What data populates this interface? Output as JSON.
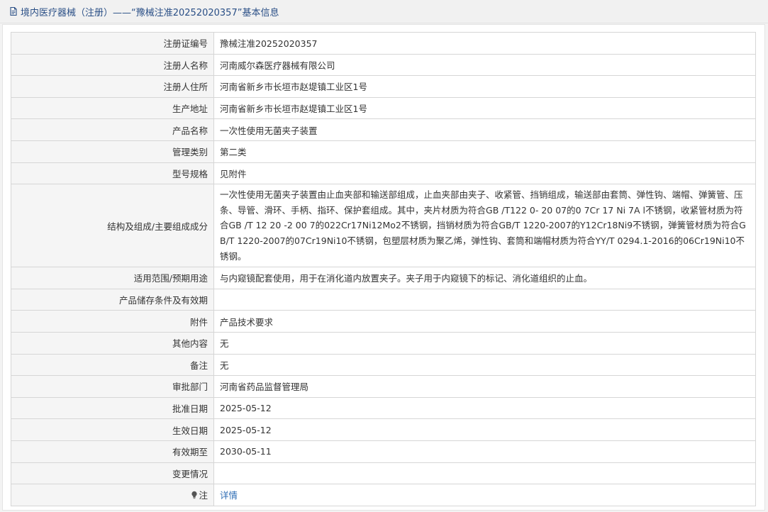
{
  "header": {
    "title": "境内医疗器械（注册）——“豫械注准20252020357”基本信息"
  },
  "rows": [
    {
      "label": "注册证编号",
      "value": "豫械注准20252020357"
    },
    {
      "label": "注册人名称",
      "value": "河南威尔森医疗器械有限公司"
    },
    {
      "label": "注册人住所",
      "value": "河南省新乡市长垣市赵堤镇工业区1号"
    },
    {
      "label": "生产地址",
      "value": "河南省新乡市长垣市赵堤镇工业区1号"
    },
    {
      "label": "产品名称",
      "value": "一次性使用无菌夹子装置"
    },
    {
      "label": "管理类别",
      "value": "第二类"
    },
    {
      "label": "型号规格",
      "value": "见附件"
    },
    {
      "label": "结构及组成/主要组成成分",
      "value": "一次性使用无菌夹子装置由止血夹部和输送部组成，止血夹部由夹子、收紧管、挡销组成，输送部由套筒、弹性钩、端帽、弹簧管、压条、导管、滑环、手柄、指环、保护套组成。其中，夹片材质为符合GB /T122 0- 20 07的0 7Cr 17 Ni 7A l不锈钢，收紧管材质为符合GB /T 12 20 -2 00 7的022Cr17Ni12Mo2不锈钢，挡销材质为符合GB/T 1220-2007的Y12Cr18Ni9不锈钢，弹簧管材质为符合GB/T 1220-2007的07Cr19Ni10不锈钢，包塑层材质为聚乙烯，弹性钩、套筒和端帽材质为符合YY/T 0294.1-2016的06Cr19Ni10不锈钢。"
    },
    {
      "label": "适用范围/预期用途",
      "value": "与内窥镜配套使用，用于在消化道内放置夹子。夹子用于内窥镜下的标记、消化道组织的止血。"
    },
    {
      "label": "产品储存条件及有效期",
      "value": ""
    },
    {
      "label": "附件",
      "value": "产品技术要求"
    },
    {
      "label": "其他内容",
      "value": "无"
    },
    {
      "label": "备注",
      "value": "无"
    },
    {
      "label": "审批部门",
      "value": "河南省药品监督管理局"
    },
    {
      "label": "批准日期",
      "value": "2025-05-12"
    },
    {
      "label": "生效日期",
      "value": "2025-05-12"
    },
    {
      "label": "有效期至",
      "value": "2030-05-11"
    },
    {
      "label": "变更情况",
      "value": ""
    }
  ],
  "note_row": {
    "label": "注",
    "icon": "bulb-icon",
    "link_label": "详情"
  },
  "colors": {
    "header_text": "#2a4f86",
    "link": "#2f6eb5",
    "border": "#d6d6d6",
    "label_bg": "#f5f5f5"
  }
}
